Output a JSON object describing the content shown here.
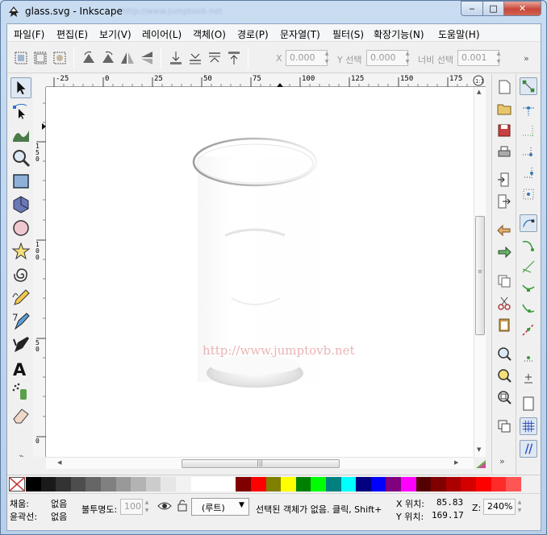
{
  "window": {
    "title": "glass.svg - Inkscape",
    "title_ghost": "http://www.jumptovb.net",
    "min_glyph": "‒",
    "max_glyph": "□",
    "close_glyph": "✕"
  },
  "menu": [
    "파일(F)",
    "편집(E)",
    "보기(V)",
    "레이어(L)",
    "객체(O)",
    "경로(P)",
    "문자열(T)",
    "필터(S)",
    "확장기능(N)",
    "도움말(H)"
  ],
  "toolbar": {
    "x_label": "X",
    "x_value": "0.000",
    "y_label": "Y 선택",
    "y_value": "0.000",
    "w_label": "너비 선택",
    "w_value": "0.001",
    "overflow": "»"
  },
  "ruler": {
    "top_ticks": [
      "-25",
      "0",
      "25",
      "50",
      "75",
      "100",
      "125",
      "150",
      "175"
    ],
    "left_ticks": [
      "1\n5\n0",
      "1\n0\n0",
      "5\n0",
      "0"
    ]
  },
  "canvas": {
    "watermark": "http://www.jumptovb.net"
  },
  "palette": {
    "colors": [
      "#000000",
      "#1a1a1a",
      "#333333",
      "#4d4d4d",
      "#666666",
      "#808080",
      "#999999",
      "#b3b3b3",
      "#cccccc",
      "#e6e6e6",
      "#f2f2f2",
      "#ffffff",
      "#ffffff",
      "#ffffff",
      "#800000",
      "#ff0000",
      "#808000",
      "#ffff00",
      "#008000",
      "#00ff00",
      "#008080",
      "#00ffff",
      "#000080",
      "#0000ff",
      "#800080",
      "#ff00ff",
      "#550000",
      "#800000",
      "#aa0000",
      "#d40000",
      "#ff0000",
      "#ff2a2a",
      "#ff5555"
    ]
  },
  "status": {
    "fill_label": "채움:",
    "fill_value": "없음",
    "stroke_label": "윤곽선:",
    "stroke_value": "없음",
    "opacity_label": "불투명도:",
    "opacity_value": "100",
    "layer_value": "(루트)",
    "message": "선택된 객체가 없음. 클릭, Shift+",
    "x_label": "X 위치:",
    "x_value": "85.83",
    "y_label": "Y 위치:",
    "y_value": "169.17",
    "zoom_label": "Z:",
    "zoom_value": "240%"
  }
}
